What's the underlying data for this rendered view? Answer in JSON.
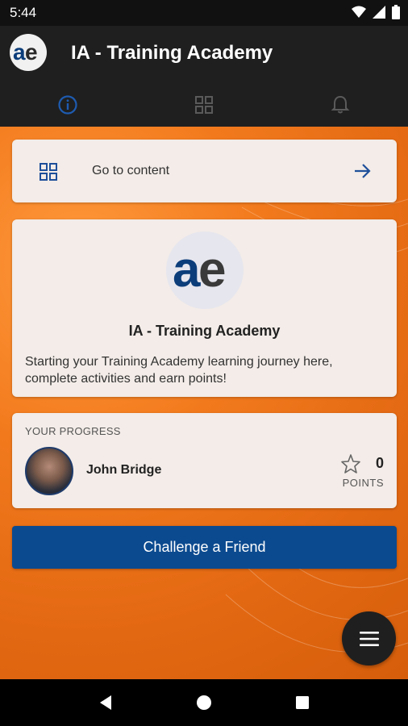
{
  "status_bar": {
    "time": "5:44"
  },
  "app_bar": {
    "title": "IA - Training Academy",
    "logo_icon": "ae-logo-icon"
  },
  "tabs": [
    {
      "icon": "info-icon",
      "active": true
    },
    {
      "icon": "grid-icon",
      "active": false
    },
    {
      "icon": "bell-icon",
      "active": false
    }
  ],
  "goto": {
    "label": "Go to content"
  },
  "info": {
    "title": "IA - Training Academy",
    "description": "Starting your Training Academy learning journey here, complete activities and earn points!"
  },
  "progress": {
    "heading": "YOUR PROGRESS",
    "user_name": "John Bridge",
    "points_value": "0",
    "points_label": "POINTS"
  },
  "challenge": {
    "label": "Challenge a Friend"
  },
  "colors": {
    "accent": "#0b4a8f",
    "background": "#f27a1d",
    "card": "#f3ece8",
    "app_bar": "#1f1f1f"
  }
}
